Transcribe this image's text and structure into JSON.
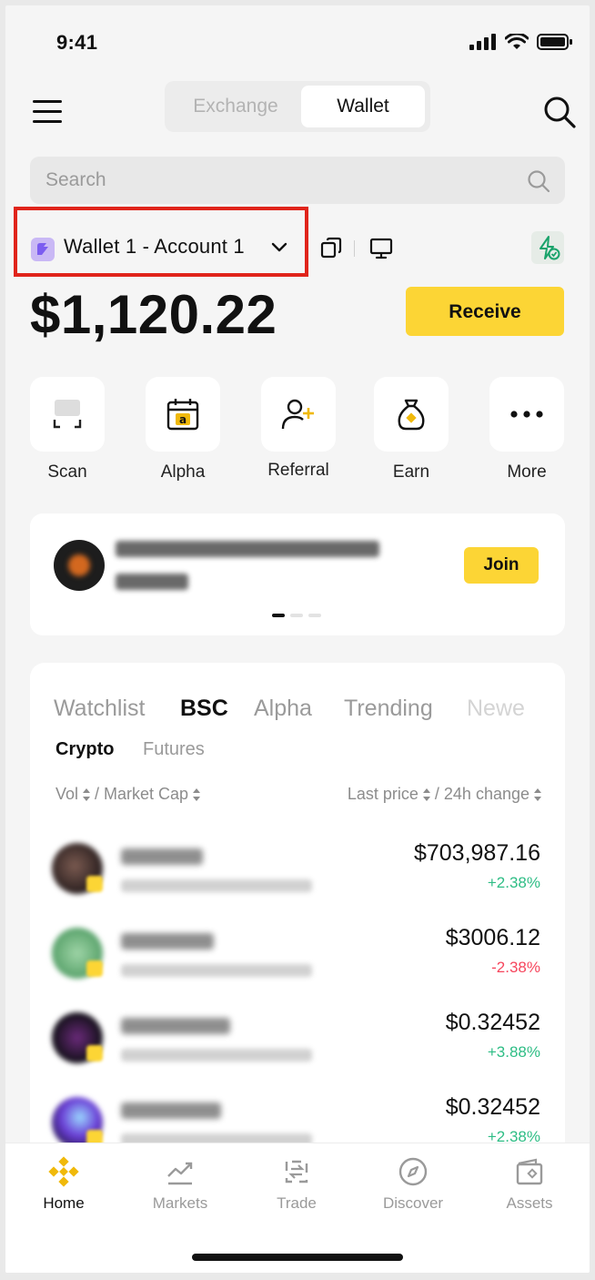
{
  "status_bar": {
    "time": "9:41"
  },
  "header": {
    "segments": [
      "Exchange",
      "Wallet"
    ],
    "active_segment": "Wallet"
  },
  "search": {
    "placeholder": "Search"
  },
  "account": {
    "label": "Wallet 1 - Account 1"
  },
  "balance": {
    "amount": "$1,120.22",
    "receive_label": "Receive"
  },
  "quick_actions": [
    {
      "label": "Scan",
      "icon": "scan-icon"
    },
    {
      "label": "Alpha",
      "icon": "alpha-calendar-icon"
    },
    {
      "label": "Referral",
      "icon": "add-user-icon"
    },
    {
      "label": "Earn",
      "icon": "money-bag-icon"
    },
    {
      "label": "More",
      "icon": "more-dots-icon"
    }
  ],
  "banner": {
    "join_label": "Join",
    "page_count": 3,
    "active_page": 1
  },
  "market": {
    "tabs": [
      "Watchlist",
      "BSC",
      "Alpha",
      "Trending",
      "Newe"
    ],
    "active_tab": "BSC",
    "subtabs": [
      "Crypto",
      "Futures"
    ],
    "active_subtab": "Crypto",
    "col_left_a": "Vol",
    "col_left_b": "/ Market Cap",
    "col_right_a": "Last price",
    "col_right_b": "/ 24h change",
    "rows": [
      {
        "price": "$703,987.16",
        "change": "+2.38%",
        "direction": "up"
      },
      {
        "price": "$3006.12",
        "change": "-2.38%",
        "direction": "down"
      },
      {
        "price": "$0.32452",
        "change": "+3.88%",
        "direction": "up"
      },
      {
        "price": "$0.32452",
        "change": "+2.38%",
        "direction": "up"
      }
    ]
  },
  "bottom_nav": [
    {
      "label": "Home",
      "icon": "home-diamond-icon",
      "active": true
    },
    {
      "label": "Markets",
      "icon": "markets-chart-icon",
      "active": false
    },
    {
      "label": "Trade",
      "icon": "trade-swap-icon",
      "active": false
    },
    {
      "label": "Discover",
      "icon": "discover-compass-icon",
      "active": false
    },
    {
      "label": "Assets",
      "icon": "assets-wallet-icon",
      "active": false
    }
  ],
  "colors": {
    "accent": "#fcd535",
    "up": "#2ebd85",
    "down": "#f6465d",
    "highlight_box": "#e0241b"
  }
}
